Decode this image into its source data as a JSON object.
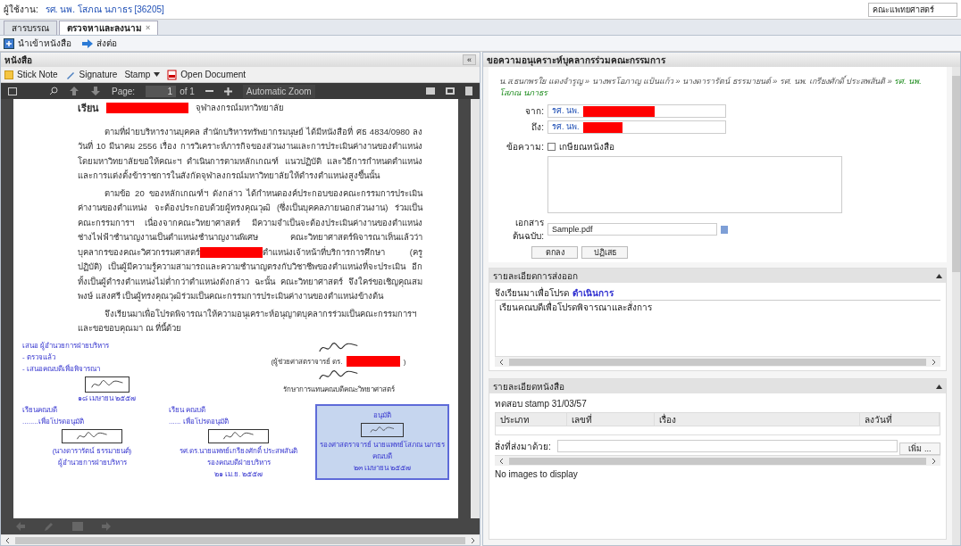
{
  "top_bar": {
    "user_label": "ผู้ใช้งาน:",
    "user_name": "รศ. นพ. โสภณ นภาธร [36205]",
    "faculty_field": "คณะแพทยศาสตร์"
  },
  "tabs": [
    {
      "label": "สารบรรณ",
      "selected": false,
      "closable": false
    },
    {
      "label": "ตรวจหาและลงนาม",
      "selected": true,
      "closable": true
    }
  ],
  "close_glyph": "×",
  "toolbar": [
    {
      "label": "นำเข้าหนังสือ",
      "kind": "import"
    },
    {
      "label": "ส่งต่อ",
      "kind": "forward"
    }
  ],
  "document_panel": {
    "title": "หนังสือ",
    "collapse_glyph": "«",
    "tools": [
      {
        "label": "Stick Note",
        "kind": "note"
      },
      {
        "label": "Signature",
        "kind": "signature"
      },
      {
        "label": "Stamp",
        "kind": "stamp"
      },
      {
        "label": "Open Document",
        "kind": "pdf"
      }
    ],
    "viewer": {
      "page_label": "Page:",
      "page": "1",
      "page_count": "of 1",
      "zoom": "Automatic Zoom"
    },
    "document": {
      "salutation": "เรียน",
      "salutation_rest": "จุฬาลงกรณ์มหาวิทยาลัย",
      "paragraph_1": "ตามที่ฝ่ายบริหารงานบุคคล สำนักบริหารทรัพยากรมนุษย์ ได้มีหนังสือที่ ศธ 4834/0980 ลงวันที่ 10 มีนาคม 2556 เรื่อง การวิเคราะห์ภารกิจของส่วนงานและการประเมินค่างานของตำแหน่งโดยมหาวิทยาลัยขอให้คณะฯ ดำเนินการตามหลักเกณฑ์ แนวปฏิบัติ และวิธีการกำหนดตำแหน่งและการแต่งตั้งข้าราชการในสังกัดจุฬาลงกรณ์มหาวิทยาลัยให้ดำรงตำแหน่งสูงขึ้นนั้น",
      "paragraph_2_before": "ตามข้อ 20 ของหลักเกณฑ์ฯ ดังกล่าว ได้กำหนดองค์ประกอบของคณะกรรมการประเมินค่างานของตำแหน่ง จะต้องประกอบด้วยผู้ทรงคุณวุฒิ (ซึ่งเป็นบุคคลภายนอกส่วนงาน) ร่วมเป็นคณะกรรมการฯ เนื่องจากคณะวิทยาศาสตร์ มีความจำเป็นจะต้องประเมินค่างานของตำแหน่งช่างไฟฟ้าชำนาญงานเป็นตำแหน่งชำนาญงานพิเศษ คณะวิทยาศาสตร์พิจารณาเห็นแล้วว่าบุคลากรของคณะวิศวกรรมศาสตร์",
      "paragraph_2_after": "ตำแหน่งเจ้าหน้าที่บริการการศึกษา (ครูปฏิบัติ) เป็นผู้มีความรู้ความสามารถและความชำนาญตรงกับวิชาชีพของตำแหน่งที่จะประเมิน อีกทั้งเป็นผู้ดำรงตำแหน่งไม่ต่ำกว่าตำแหน่งดังกล่าว ฉะนั้น คณะวิทยาศาสตร์ จึงใคร่ขอเชิญคุณสมพงษ์ แสงศรี เป็นผู้ทรงคุณวุฒิร่วมเป็นคณะกรรมการประเมินค่างานของตำแหน่งข้างต้น",
      "paragraph_3": "จึงเรียนมาเพื่อโปรดพิจารณาให้ความอนุเคราะห์อนุญาตบุคลากรร่วมเป็นคณะกรรมการฯ และขอขอบคุณมา ณ ที่นี้ด้วย",
      "notes": [
        "เสนอ ผู้อำนวยการฝ่ายบริหาร",
        "- ตรวจแล้ว",
        "- เสนอคณบดีเพื่อพิจารณา"
      ],
      "note_date": "๑๘ เมษายน ๒๕๕๗",
      "signer_title": "(ผู้ช่วยศาสตราจารย์ ดร.",
      "signer_close": ")",
      "signer_role": "รักษาการแทนคณบดีคณะวิทยาศาสตร์",
      "approvals": [
        {
          "kind": "note",
          "lines_before": [
            "เรียนคณบดี",
            "........เพื่อโปรดอนุมัติ"
          ],
          "lines_after": [
            "(นางดารารัตน์ ธรรมายนต์)",
            "ผู้อำนวยการฝ่ายบริหาร"
          ]
        },
        {
          "kind": "note",
          "lines_before": [
            "เรียน คณบดี",
            "...... เพื่อโปรดอนุมัติ"
          ],
          "lines_after": [
            "รศ.ดร.นายแพทย์เกรียงศักดิ์ ประสพสันติ",
            "รองคณบดีฝ่ายบริหาร",
            "๒๑ เม.ย. ๒๕๕๗"
          ]
        },
        {
          "kind": "stamp",
          "lines_before": [
            "อนุมัติ"
          ],
          "lines_after": [
            "รองศาสตราจารย์ นายแพทย์โสภณ นภาธร",
            "คณบดี",
            "๒๓ เมษายน ๒๕๕๗"
          ]
        }
      ]
    }
  },
  "approval_panel": {
    "title": "ขอความอนุเคราะห์บุคลากรร่วมคณะกรรมการ",
    "separator": "»",
    "path": [
      {
        "name": "น.ส.ธนกพรใย แดงจำรูญ",
        "current": false
      },
      {
        "name": "นางพรโอภาญ แป้นแก้ว",
        "current": false
      },
      {
        "name": "นางดารารัตน์ ธรรมายนต์",
        "current": false
      },
      {
        "name": "รศ. นพ. เกรียงศักดิ์ ประสพสันติ",
        "current": false
      },
      {
        "name": "รศ. นพ. โสภณ นภาธร",
        "current": true
      }
    ],
    "from_label": "จาก:",
    "from_value": "รศ. นพ.",
    "to_label": "ถึง:",
    "to_value": "รศ. นพ.",
    "message_label": "ข้อความ:",
    "retire_label": "เกษียณหนังสือ",
    "retire_checked": false,
    "attachment_label": "เอกสารต้นฉบับ:",
    "attachment_value": "Sample.pdf",
    "buttons": [
      "ตกลง",
      "ปฏิเสธ"
    ]
  },
  "export_section": {
    "title": "รายละเอียดการส่งออก",
    "intro": "จึงเรียนมาเพื่อโปรด",
    "action": "ดำเนินการ",
    "body": "เรียนคณบดีเพื่อโปรดพิจารณาและสั่งการ"
  },
  "details_section": {
    "title": "รายละเอียดหนังสือ",
    "subject": "ทดสอบ stamp 31/03/57",
    "columns": [
      "ประเภท",
      "เลขที่",
      "เรื่อง",
      "ลงวันที่"
    ],
    "enclosure_label": "สิ่งที่ส่งมาด้วย:",
    "add_button": "เพิ่ม ...",
    "empty_text": "No images to display"
  }
}
